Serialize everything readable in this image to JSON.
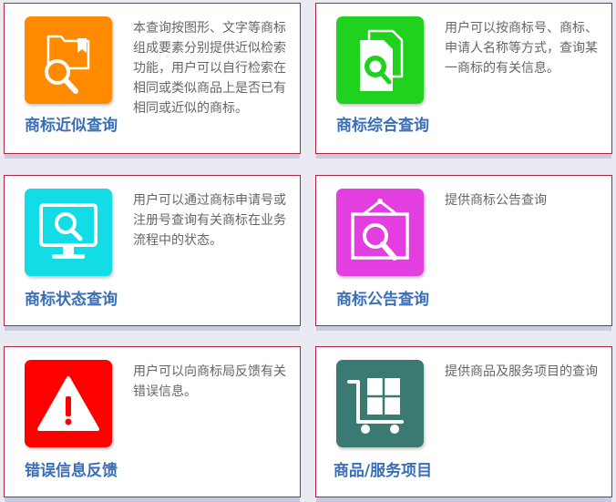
{
  "cards": [
    {
      "title": "商标近似查询",
      "description": "本查询按图形、文字等商标组成要素分别提供近似检索功能，用户可以自行检索在相同或类似商品上是否已有相同或近似的商标。",
      "icon": "folder-search-icon",
      "color": "#ff8a00"
    },
    {
      "title": "商标综合查询",
      "description": "用户可以按商标号、商标、申请人名称等方式，查询某一商标的有关信息。",
      "icon": "documents-search-icon",
      "color": "#1ed21e"
    },
    {
      "title": "商标状态查询",
      "description": "用户可以通过商标申请号或注册号查询有关商标在业务流程中的状态。",
      "icon": "monitor-search-icon",
      "color": "#12dce6"
    },
    {
      "title": "商标公告查询",
      "description": "提供商标公告查询",
      "icon": "notice-board-search-icon",
      "color": "#e23ee0"
    },
    {
      "title": "错误信息反馈",
      "description": "用户可以向商标局反馈有关错误信息。",
      "icon": "warning-icon",
      "color": "#ff0000"
    },
    {
      "title": "商品/服务项目",
      "description": "提供商品及服务项目的查询",
      "icon": "cart-icon",
      "color": "#3a7a73"
    }
  ]
}
